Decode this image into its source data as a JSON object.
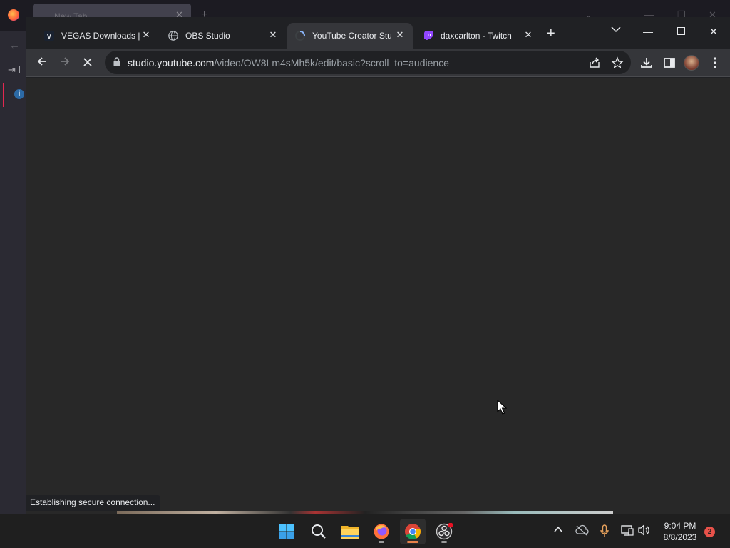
{
  "background_window": {
    "tab_title": "New Tab",
    "sidebar_label_partial": "⇥ I"
  },
  "tabs": [
    {
      "title": "VEGAS Downloads | D",
      "icon": "vegas-icon",
      "active": false
    },
    {
      "title": "OBS Studio",
      "icon": "globe-icon",
      "active": false
    },
    {
      "title": "YouTube Creator Stu",
      "icon": "loading-spinner-icon",
      "active": true
    },
    {
      "title": "daxcarlton - Twitch",
      "icon": "twitch-icon",
      "active": false
    }
  ],
  "toolbar": {
    "url_host": "studio.youtube.com",
    "url_path": "/video/OW8Lm4sMh5k/edit/basic?scroll_to=audience"
  },
  "status_text": "Establishing secure connection...",
  "taskbar": {
    "apps": [
      "windows-start",
      "search",
      "file-explorer",
      "firefox",
      "chrome",
      "obs-studio"
    ],
    "time": "9:04 PM",
    "date": "8/8/2023",
    "notification_count": "2"
  },
  "colors": {
    "chrome_frame": "#202124",
    "toolbar": "#35363a",
    "page_bg": "#282828",
    "twitch_purple": "#9146ff",
    "accent_red": "#e8524a"
  }
}
